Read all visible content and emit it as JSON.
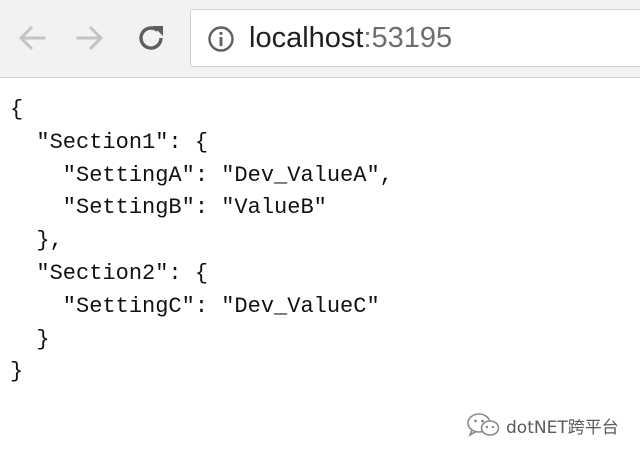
{
  "browser": {
    "back_icon": "arrow-left-icon",
    "forward_icon": "arrow-right-icon",
    "reload_icon": "reload-icon",
    "info_icon": "info-circle-icon",
    "url_host": "localhost",
    "url_port": ":53195"
  },
  "json_view": {
    "lines": [
      "{",
      "  \"Section1\": {",
      "    \"SettingA\": \"Dev_ValueA\",",
      "    \"SettingB\": \"ValueB\"",
      "  },",
      "  \"Section2\": {",
      "    \"SettingC\": \"Dev_ValueC\"",
      "  }",
      "}"
    ]
  },
  "watermark": {
    "icon": "wechat-icon",
    "text": "dotNET跨平台"
  },
  "colors": {
    "toolbar_bg": "#f2f2f2",
    "icon_disabled": "#c4c4c4",
    "icon_active": "#5f5f5f",
    "text": "#111111"
  }
}
